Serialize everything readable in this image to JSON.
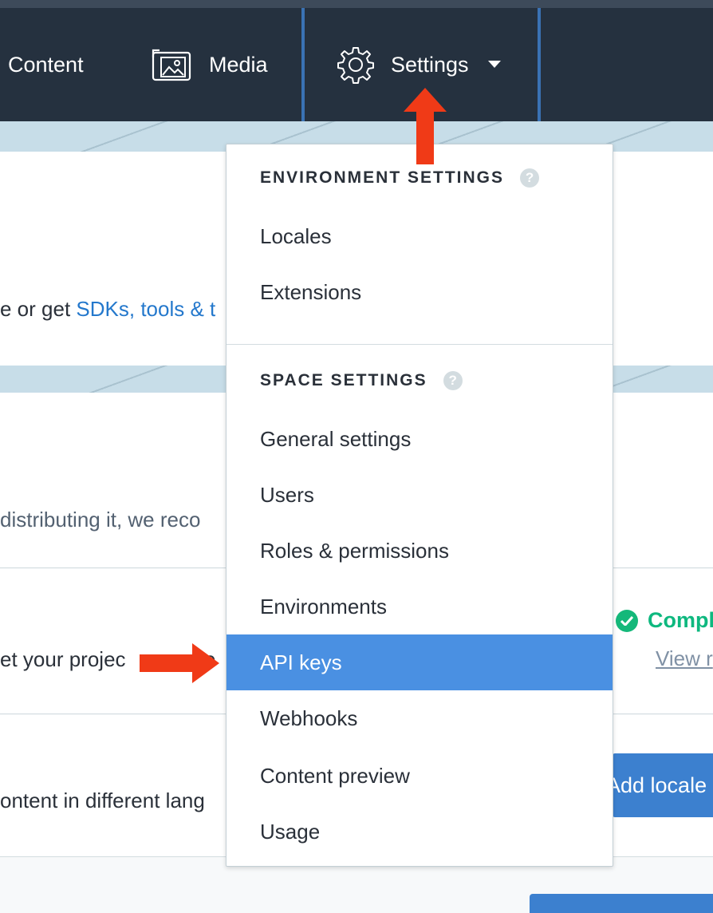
{
  "nav": {
    "content_label": "Content",
    "media_label": "Media",
    "settings_label": "Settings"
  },
  "background": {
    "line1_prefix": "e or get ",
    "line1_link": "SDKs, tools & t",
    "line2": "distributing it, we reco",
    "line3": "et your projec",
    "line3_suffix": "e",
    "line4": "ontent in different lang",
    "complete_label": "Compl",
    "view_label": "View r",
    "add_locale_label": "Add locale"
  },
  "dropdown": {
    "environment_heading": "ENVIRONMENT SETTINGS",
    "space_heading": "SPACE SETTINGS",
    "help_glyph": "?",
    "environment_items": [
      {
        "label": "Locales"
      },
      {
        "label": "Extensions"
      }
    ],
    "space_items": [
      {
        "label": "General settings"
      },
      {
        "label": "Users"
      },
      {
        "label": "Roles & permissions"
      },
      {
        "label": "Environments"
      },
      {
        "label": "API keys",
        "active": true
      },
      {
        "label": "Webhooks"
      },
      {
        "label": "Content preview"
      },
      {
        "label": "Usage"
      }
    ]
  },
  "colors": {
    "nav_bg": "#25313f",
    "active_item_bg": "#4a90e2",
    "annotation_arrow": "#f03a17",
    "link": "#2478cc",
    "success": "#0eb87f"
  },
  "icons": [
    "media-icon",
    "gear-icon",
    "chevron-down-icon",
    "help-icon",
    "check-icon",
    "red-arrow-up",
    "red-arrow-right"
  ]
}
